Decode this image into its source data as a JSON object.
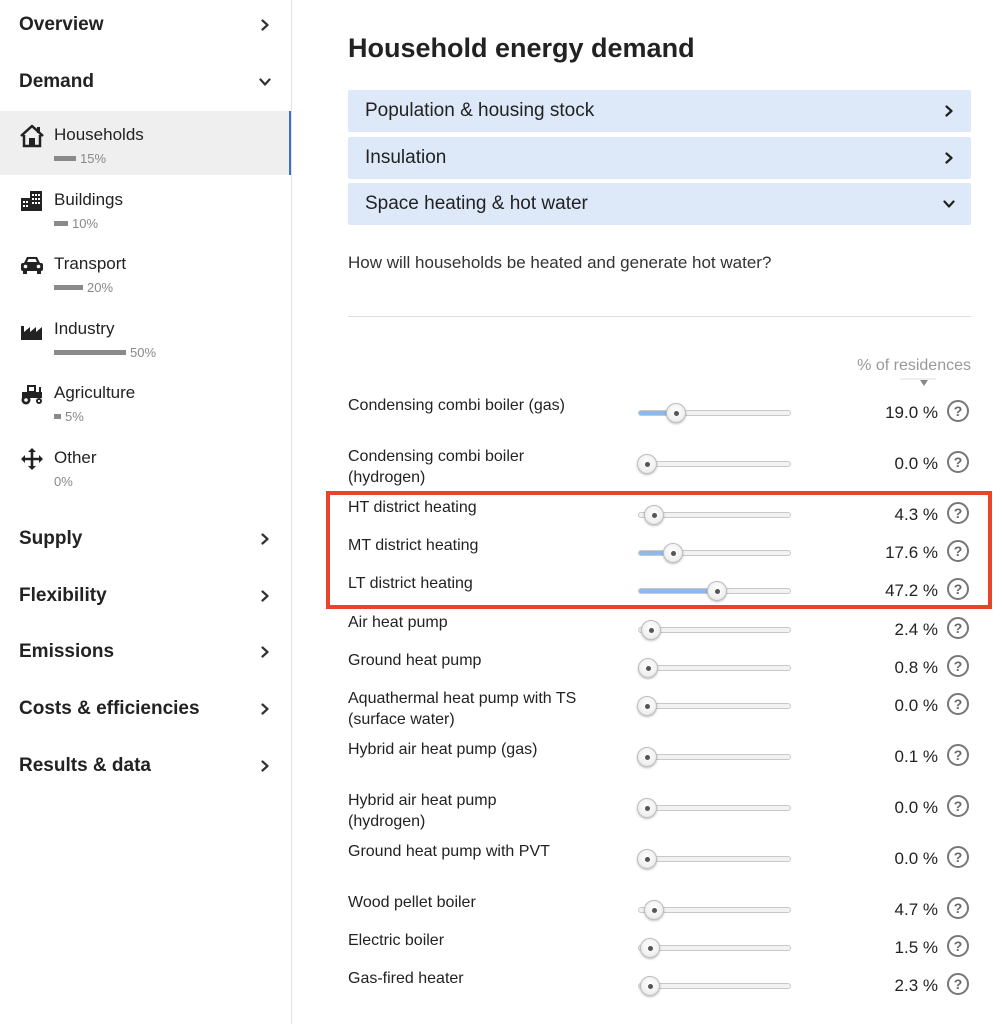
{
  "sidebar": {
    "overview": {
      "label": "Overview"
    },
    "demand": {
      "label": "Demand"
    },
    "categories": [
      {
        "label": "Households",
        "pct": "15%",
        "icon": "house-icon",
        "share": 0.15
      },
      {
        "label": "Buildings",
        "pct": "10%",
        "icon": "buildings-icon",
        "share": 0.1
      },
      {
        "label": "Transport",
        "pct": "20%",
        "icon": "car-icon",
        "share": 0.2
      },
      {
        "label": "Industry",
        "pct": "50%",
        "icon": "factory-icon",
        "share": 0.5
      },
      {
        "label": "Agriculture",
        "pct": "5%",
        "icon": "tractor-icon",
        "share": 0.05
      },
      {
        "label": "Other",
        "pct": "0%",
        "icon": "move-arrows-icon",
        "share": 0.0
      }
    ],
    "sections": [
      {
        "label": "Supply"
      },
      {
        "label": "Flexibility"
      },
      {
        "label": "Emissions"
      },
      {
        "label": "Costs & efficiencies"
      },
      {
        "label": "Results & data"
      }
    ]
  },
  "main": {
    "title": "Household energy demand",
    "accordions": [
      {
        "label": "Population & housing stock",
        "state": "collapsed"
      },
      {
        "label": "Insulation",
        "state": "collapsed"
      },
      {
        "label": "Space heating & hot water",
        "state": "expanded"
      }
    ],
    "question": "How will households be heated and generate hot water?",
    "column_header": "% of residences",
    "sliders": [
      {
        "label": "Condensing combi boiler (gas)",
        "value": "19.0 %",
        "level": 0.2,
        "filled": true
      },
      {
        "label": "Condensing combi boiler (hydrogen)",
        "value": "0.0 %",
        "level": 0.0,
        "filled": false
      },
      {
        "label": "HT district heating",
        "value": "4.3 %",
        "level": 0.05,
        "filled": false
      },
      {
        "label": "MT district heating",
        "value": "17.6 %",
        "level": 0.18,
        "filled": true
      },
      {
        "label": "LT district heating",
        "value": "47.2 %",
        "level": 0.48,
        "filled": true
      },
      {
        "label": "Air heat pump",
        "value": "2.4 %",
        "level": 0.03,
        "filled": false
      },
      {
        "label": "Ground heat pump",
        "value": "0.8 %",
        "level": 0.01,
        "filled": false
      },
      {
        "label": "Aquathermal heat pump with TS (surface water)",
        "value": "0.0 %",
        "level": 0.0,
        "filled": false
      },
      {
        "label": "Hybrid air heat pump (gas)",
        "value": "0.1 %",
        "level": 0.0,
        "filled": false
      },
      {
        "label": "Hybrid air heat pump (hydrogen)",
        "value": "0.0 %",
        "level": 0.0,
        "filled": false
      },
      {
        "label": "Ground heat pump with PVT",
        "value": "0.0 %",
        "level": 0.0,
        "filled": false
      },
      {
        "label": "Wood pellet boiler",
        "value": "4.7 %",
        "level": 0.05,
        "filled": false
      },
      {
        "label": "Electric boiler",
        "value": "1.5 %",
        "level": 0.02,
        "filled": false
      },
      {
        "label": "Gas-fired heater",
        "value": "2.3 %",
        "level": 0.02,
        "filled": false
      }
    ],
    "help_symbol": "?"
  },
  "colors": {
    "accordion_bg": "#dde9f8",
    "slider_fill": "#8fb9ea",
    "highlight": "#e8432c",
    "active_row": "#efefef"
  }
}
